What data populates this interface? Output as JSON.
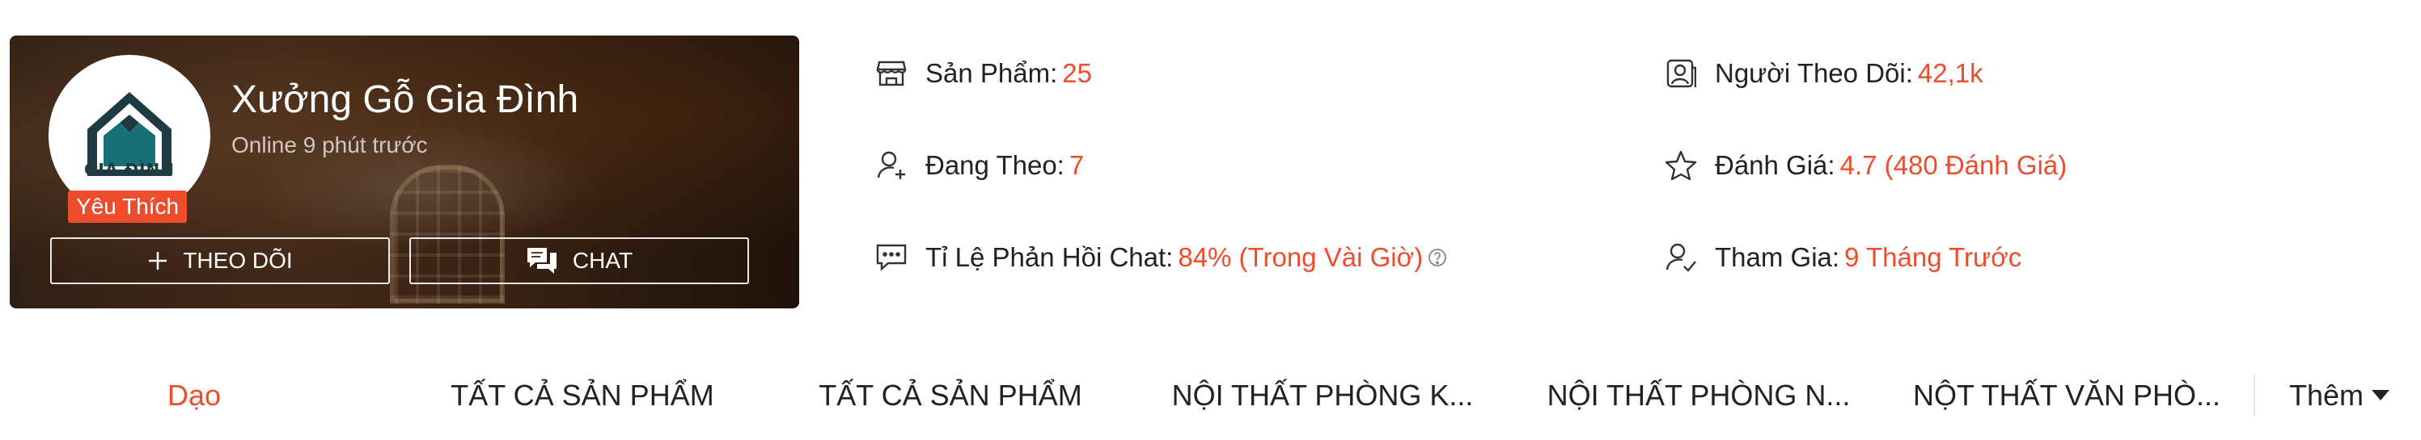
{
  "shop": {
    "name": "Xưởng Gỗ Gia Đình",
    "status": "Online 9 phút trước",
    "logo_text": "GIA ĐÌNH",
    "badge": "Yêu Thích",
    "follow_label": "THEO DÕI",
    "chat_label": "CHAT"
  },
  "stats": {
    "products": {
      "label": "Sản Phẩm:",
      "value": "25",
      "icon": "store-icon"
    },
    "followers": {
      "label": "Người Theo Dõi:",
      "value": "42,1k",
      "icon": "followers-icon"
    },
    "following": {
      "label": "Đang Theo:",
      "value": "7",
      "icon": "user-plus-icon"
    },
    "rating": {
      "label": "Đánh Giá:",
      "value": "4.7 (480 Đánh Giá)",
      "icon": "star-icon"
    },
    "chat_response": {
      "label": "Tỉ Lệ Phản Hồi Chat:",
      "value": "84% (Trong Vài Giờ)",
      "icon": "chat-bubble-icon"
    },
    "joined": {
      "label": "Tham Gia:",
      "value": "9 Tháng Trước",
      "icon": "user-check-icon"
    }
  },
  "nav": {
    "items": [
      {
        "label": "Dạo",
        "active": true
      },
      {
        "label": "TẤT CẢ SẢN PHẨM"
      },
      {
        "label": "TẤT CẢ SẢN PHẨM"
      },
      {
        "label": "NỘI THẤT PHÒNG K..."
      },
      {
        "label": "NỘI THẤT PHÒNG N..."
      },
      {
        "label": "NỘT THẤT VĂN PHÒ..."
      }
    ],
    "more_label": "Thêm"
  },
  "colors": {
    "accent": "#ee4d2d",
    "logo_teal": "#157177",
    "logo_dark": "#1d3b40"
  }
}
